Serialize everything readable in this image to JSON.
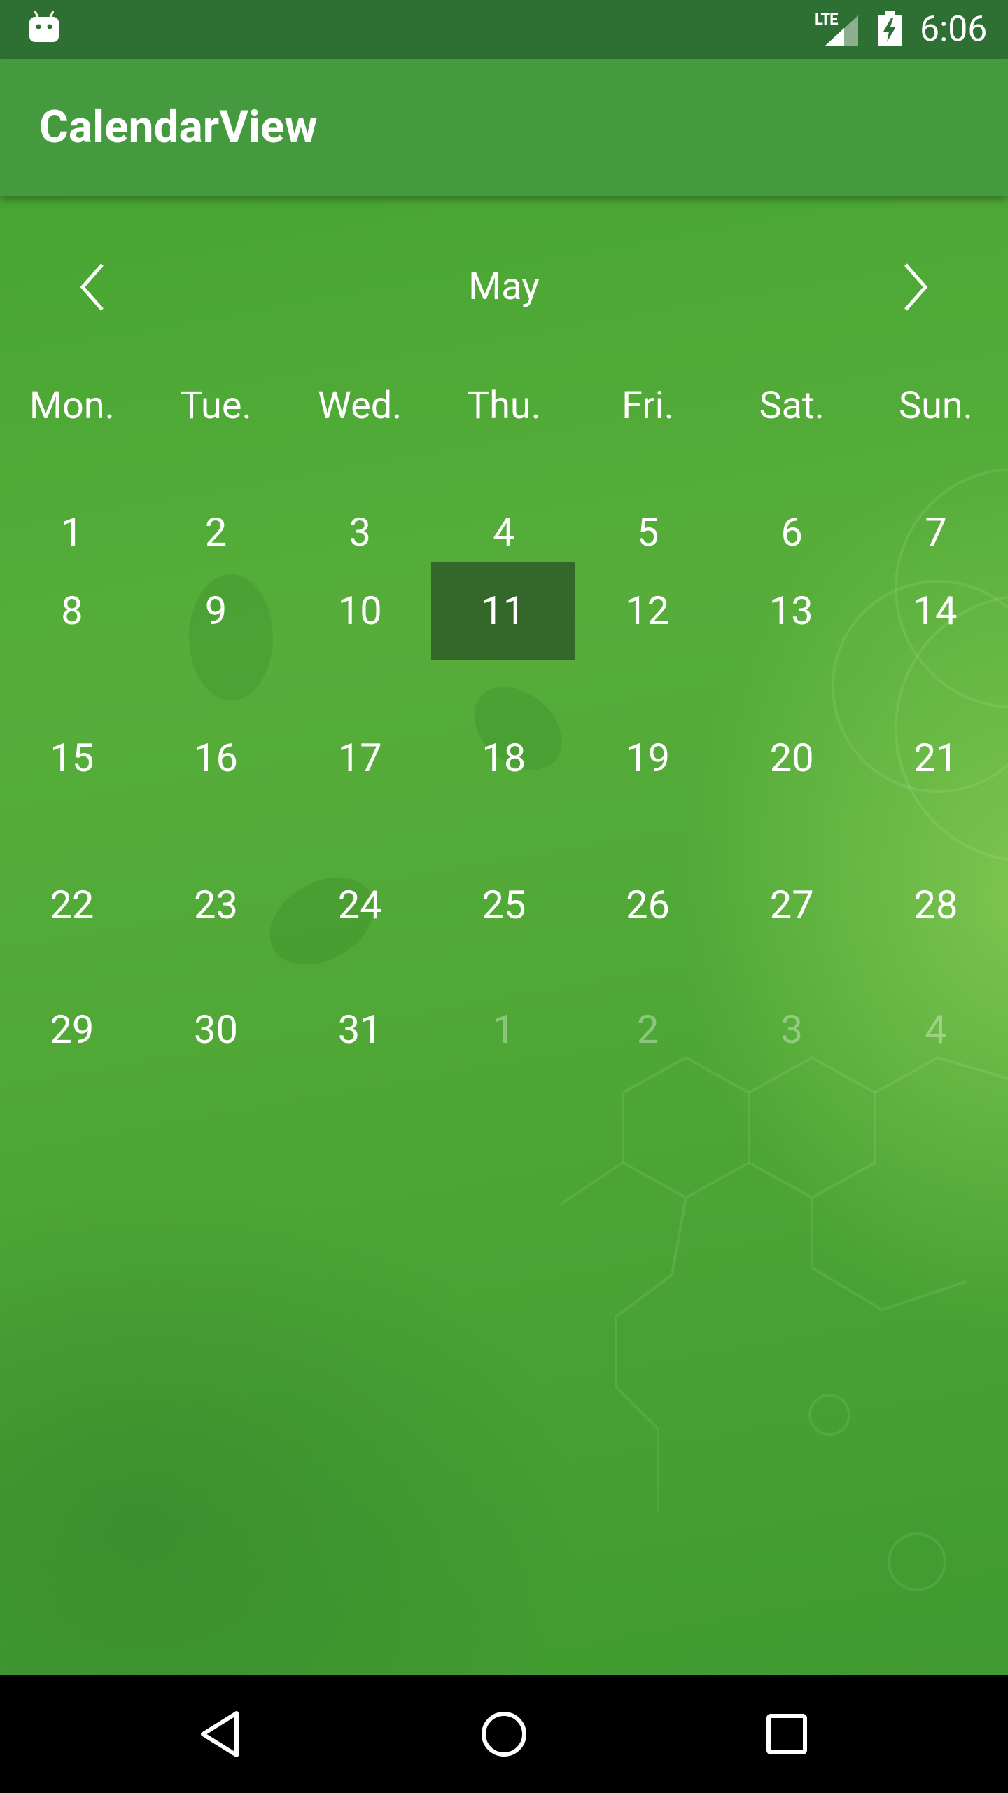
{
  "status_bar": {
    "network_label": "LTE",
    "time": "6:06",
    "notification_icon": "android-icon",
    "signal_icon": "signal-icon",
    "battery_icon": "battery-charging-icon"
  },
  "app_bar": {
    "title": "CalendarView"
  },
  "calendar": {
    "month": "May",
    "prev_icon": "chevron-left-icon",
    "next_icon": "chevron-right-icon",
    "weekdays": [
      "Mon.",
      "Tue.",
      "Wed.",
      "Thu.",
      "Fri.",
      "Sat.",
      "Sun."
    ],
    "weeks": [
      [
        "1",
        "2",
        "3",
        "4",
        "5",
        "6",
        "7"
      ],
      [
        "8",
        "9",
        "10",
        "11",
        "12",
        "13",
        "14"
      ],
      [
        "15",
        "16",
        "17",
        "18",
        "19",
        "20",
        "21"
      ],
      [
        "22",
        "23",
        "24",
        "25",
        "26",
        "27",
        "28"
      ],
      [
        "29",
        "30",
        "31",
        "1",
        "2",
        "3",
        "4"
      ]
    ],
    "selected_day": "11",
    "colors": {
      "selected_background": "#34672a",
      "app_bar": "#45993f",
      "status_bar": "#2e7033"
    }
  },
  "nav_bar": {
    "back_icon": "back-triangle-icon",
    "home_icon": "home-circle-icon",
    "recents_icon": "recents-square-icon"
  }
}
